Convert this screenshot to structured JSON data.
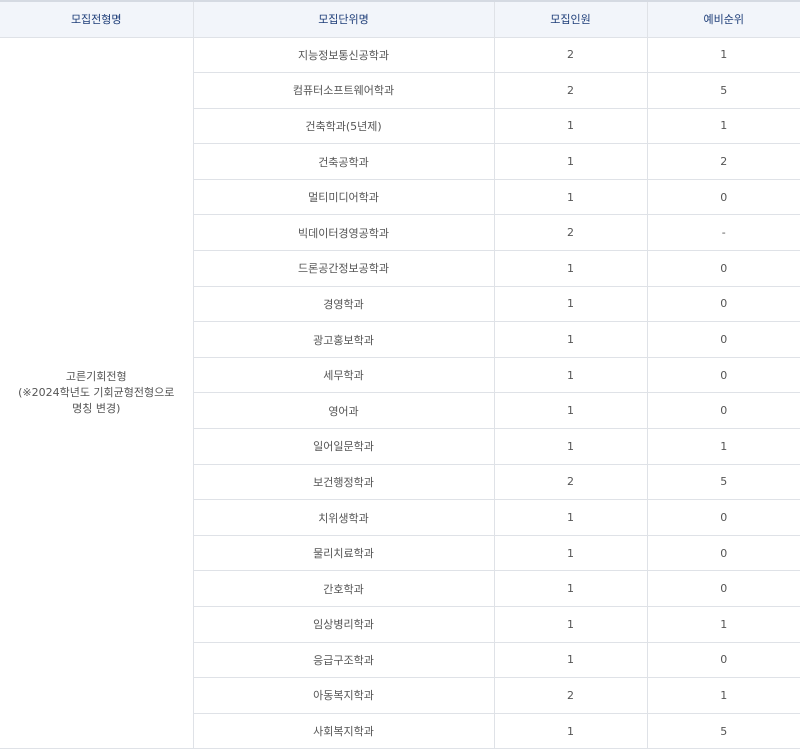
{
  "table": {
    "headers": [
      "모집전형명",
      "모집단위명",
      "모집인원",
      "예비순위"
    ],
    "track": {
      "name": "고른기회전형",
      "note": "(※2024학년도 기회균형전형으로 명칭 변경)"
    },
    "rows": [
      {
        "unit": "지능정보통신공학과",
        "quota": "2",
        "reserve": "1"
      },
      {
        "unit": "컴퓨터소프트웨어학과",
        "quota": "2",
        "reserve": "5"
      },
      {
        "unit": "건축학과(5년제)",
        "quota": "1",
        "reserve": "1"
      },
      {
        "unit": "건축공학과",
        "quota": "1",
        "reserve": "2"
      },
      {
        "unit": "멀티미디어학과",
        "quota": "1",
        "reserve": "0"
      },
      {
        "unit": "빅데이터경영공학과",
        "quota": "2",
        "reserve": "-"
      },
      {
        "unit": "드론공간정보공학과",
        "quota": "1",
        "reserve": "0"
      },
      {
        "unit": "경영학과",
        "quota": "1",
        "reserve": "0"
      },
      {
        "unit": "광고홍보학과",
        "quota": "1",
        "reserve": "0"
      },
      {
        "unit": "세무학과",
        "quota": "1",
        "reserve": "0"
      },
      {
        "unit": "영어과",
        "quota": "1",
        "reserve": "0"
      },
      {
        "unit": "일어일문학과",
        "quota": "1",
        "reserve": "1"
      },
      {
        "unit": "보건행정학과",
        "quota": "2",
        "reserve": "5"
      },
      {
        "unit": "치위생학과",
        "quota": "1",
        "reserve": "0"
      },
      {
        "unit": "물리치료학과",
        "quota": "1",
        "reserve": "0"
      },
      {
        "unit": "간호학과",
        "quota": "1",
        "reserve": "0"
      },
      {
        "unit": "임상병리학과",
        "quota": "1",
        "reserve": "1"
      },
      {
        "unit": "응급구조학과",
        "quota": "1",
        "reserve": "0"
      },
      {
        "unit": "아동복지학과",
        "quota": "2",
        "reserve": "1"
      },
      {
        "unit": "사회복지학과",
        "quota": "1",
        "reserve": "5"
      }
    ]
  }
}
